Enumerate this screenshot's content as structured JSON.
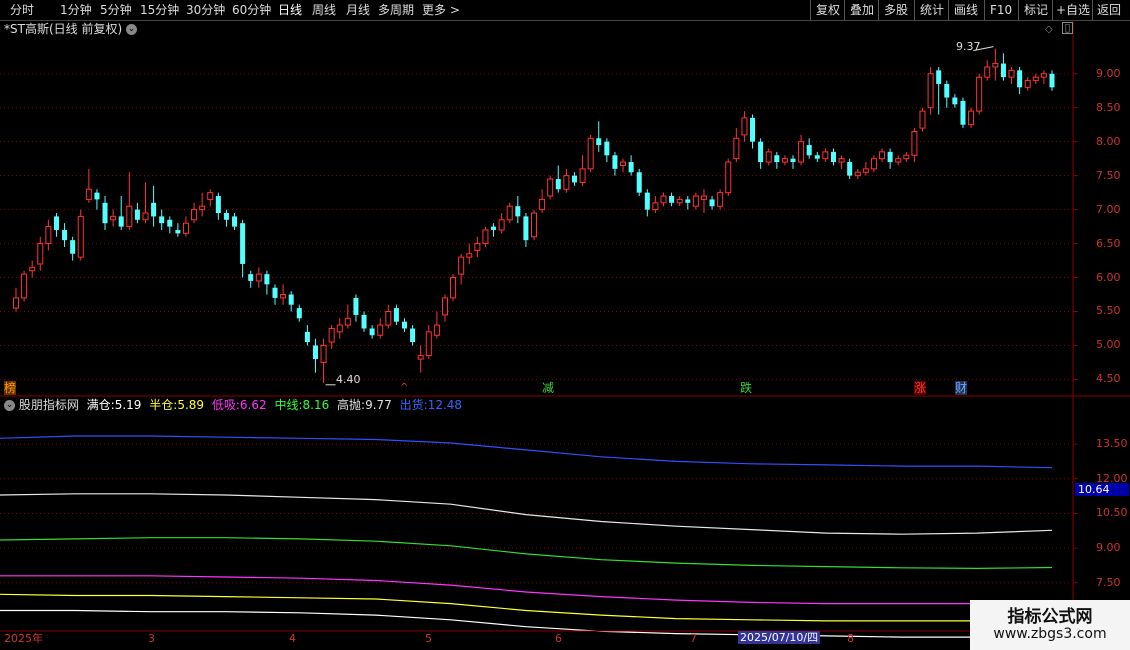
{
  "toolbar": {
    "periods": [
      "分时",
      "1分钟",
      "5分钟",
      "15分钟",
      "30分钟",
      "60分钟",
      "日线",
      "周线",
      "月线",
      "多周期",
      "更多 >"
    ],
    "active_period": "日线",
    "right_buttons": [
      "复权",
      "叠加",
      "多股",
      "统计",
      "画线",
      "F10",
      "标记",
      "+自选",
      "返回"
    ]
  },
  "stock": {
    "title": "*ST高斯(日线 前复权)",
    "high_label": "9.37",
    "low_label": "4.40"
  },
  "signals": [
    {
      "text": "榜",
      "color": "#ff9900"
    },
    {
      "text": "^",
      "color": "#ff3333"
    },
    {
      "text": "减",
      "color": "#3cd33c"
    },
    {
      "text": "跌",
      "color": "#3cd33c"
    },
    {
      "text": "涨",
      "color": "#ff3333"
    },
    {
      "text": "财",
      "color": "#66aaff"
    }
  ],
  "indicator": {
    "name": "股朋指标网",
    "items": [
      {
        "label": "满仓:",
        "value": "5.19",
        "color": "#ffffff"
      },
      {
        "label": "半仓:",
        "value": "5.89",
        "color": "#ffff33"
      },
      {
        "label": "低吸:",
        "value": "6.62",
        "color": "#ff33ff"
      },
      {
        "label": "中线:",
        "value": "8.16",
        "color": "#33ff33"
      },
      {
        "label": "高抛:",
        "value": "9.77",
        "color": "#e0e0e0"
      },
      {
        "label": "出货:",
        "value": "12.48",
        "color": "#3366ff"
      }
    ],
    "current_tag": "10.64"
  },
  "axis": {
    "price_ticks": [
      "9.00",
      "8.50",
      "8.00",
      "7.50",
      "7.00",
      "6.50",
      "6.00",
      "5.50",
      "5.00",
      "4.50"
    ],
    "indicator_ticks": [
      "13.50",
      "12.00",
      "10.50",
      "9.00",
      "7.50"
    ],
    "date_labels": [
      "2025年",
      "3",
      "4",
      "5",
      "6",
      "7",
      "2025/07/10/四",
      "8"
    ]
  },
  "watermark": {
    "main": "指标公式网",
    "url": "www.zbgs3.com"
  },
  "colors": {
    "up": "#ff3333",
    "down": "#54ffff",
    "grid": "#8b0000",
    "axis": "#8b0000"
  },
  "chart_data": {
    "type": "candlestick",
    "price_ylim": [
      4.3,
      9.6
    ],
    "candles": [
      [
        5.55,
        5.7,
        5.5,
        5.85
      ],
      [
        5.7,
        6.05,
        5.65,
        6.1
      ],
      [
        6.1,
        6.15,
        6.0,
        6.25
      ],
      [
        6.2,
        6.5,
        6.1,
        6.6
      ],
      [
        6.5,
        6.75,
        6.4,
        6.85
      ],
      [
        6.9,
        6.7,
        6.6,
        6.95
      ],
      [
        6.7,
        6.55,
        6.45,
        6.8
      ],
      [
        6.55,
        6.35,
        6.25,
        6.6
      ],
      [
        6.3,
        6.9,
        6.25,
        7.0
      ],
      [
        7.15,
        7.3,
        7.1,
        7.6
      ],
      [
        7.25,
        7.15,
        7.0,
        7.3
      ],
      [
        7.1,
        6.8,
        6.7,
        7.2
      ],
      [
        6.85,
        6.9,
        6.75,
        7.0
      ],
      [
        6.9,
        6.75,
        6.7,
        7.2
      ],
      [
        6.75,
        7.05,
        6.7,
        7.55
      ],
      [
        7.0,
        6.85,
        6.8,
        7.1
      ],
      [
        6.85,
        6.95,
        6.8,
        7.4
      ],
      [
        7.1,
        6.9,
        6.75,
        7.35
      ],
      [
        6.9,
        6.8,
        6.7,
        7.0
      ],
      [
        6.85,
        6.75,
        6.65,
        6.9
      ],
      [
        6.7,
        6.65,
        6.6,
        6.8
      ],
      [
        6.65,
        6.8,
        6.6,
        6.9
      ],
      [
        6.85,
        7.0,
        6.8,
        7.1
      ],
      [
        7.0,
        7.05,
        6.9,
        7.25
      ],
      [
        7.15,
        7.25,
        7.05,
        7.3
      ],
      [
        7.2,
        6.95,
        6.85,
        7.25
      ],
      [
        6.95,
        6.85,
        6.75,
        7.0
      ],
      [
        6.9,
        6.75,
        6.7,
        6.95
      ],
      [
        6.8,
        6.2,
        6.0,
        6.85
      ],
      [
        6.05,
        5.95,
        5.85,
        6.1
      ],
      [
        5.95,
        6.05,
        5.85,
        6.15
      ],
      [
        6.05,
        5.9,
        5.75,
        6.1
      ],
      [
        5.85,
        5.7,
        5.6,
        5.9
      ],
      [
        5.7,
        5.75,
        5.6,
        5.9
      ],
      [
        5.75,
        5.6,
        5.5,
        5.8
      ],
      [
        5.55,
        5.4,
        5.35,
        5.6
      ],
      [
        5.2,
        5.05,
        5.0,
        5.3
      ],
      [
        5.0,
        4.8,
        4.6,
        5.1
      ],
      [
        4.75,
        5.0,
        4.45,
        5.1
      ],
      [
        5.05,
        5.25,
        4.95,
        5.3
      ],
      [
        5.2,
        5.3,
        5.1,
        5.4
      ],
      [
        5.3,
        5.4,
        5.25,
        5.6
      ],
      [
        5.7,
        5.45,
        5.35,
        5.75
      ],
      [
        5.45,
        5.25,
        5.2,
        5.5
      ],
      [
        5.25,
        5.15,
        5.1,
        5.3
      ],
      [
        5.15,
        5.3,
        5.1,
        5.4
      ],
      [
        5.3,
        5.5,
        5.25,
        5.6
      ],
      [
        5.55,
        5.35,
        5.3,
        5.6
      ],
      [
        5.35,
        5.25,
        5.2,
        5.4
      ],
      [
        5.25,
        5.05,
        5.0,
        5.3
      ],
      [
        4.8,
        4.85,
        4.6,
        5.0
      ],
      [
        4.85,
        5.2,
        4.8,
        5.3
      ],
      [
        5.15,
        5.3,
        5.1,
        5.5
      ],
      [
        5.45,
        5.7,
        5.35,
        5.75
      ],
      [
        5.7,
        6.0,
        5.65,
        6.05
      ],
      [
        6.05,
        6.3,
        5.9,
        6.35
      ],
      [
        6.3,
        6.35,
        6.2,
        6.5
      ],
      [
        6.4,
        6.5,
        6.3,
        6.6
      ],
      [
        6.5,
        6.7,
        6.45,
        6.75
      ],
      [
        6.75,
        6.7,
        6.6,
        6.8
      ],
      [
        6.7,
        6.85,
        6.65,
        6.95
      ],
      [
        6.85,
        7.05,
        6.8,
        7.1
      ],
      [
        7.05,
        6.9,
        6.8,
        7.2
      ],
      [
        6.9,
        6.55,
        6.45,
        6.95
      ],
      [
        6.6,
        6.95,
        6.55,
        7.0
      ],
      [
        7.0,
        7.15,
        6.95,
        7.3
      ],
      [
        7.2,
        7.45,
        7.15,
        7.5
      ],
      [
        7.45,
        7.3,
        7.25,
        7.65
      ],
      [
        7.3,
        7.5,
        7.25,
        7.6
      ],
      [
        7.5,
        7.4,
        7.35,
        7.55
      ],
      [
        7.4,
        7.6,
        7.35,
        7.8
      ],
      [
        7.6,
        8.05,
        7.55,
        8.1
      ],
      [
        8.05,
        7.95,
        7.85,
        8.3
      ],
      [
        8.0,
        7.8,
        7.7,
        8.05
      ],
      [
        7.8,
        7.6,
        7.5,
        7.85
      ],
      [
        7.65,
        7.7,
        7.55,
        7.75
      ],
      [
        7.7,
        7.55,
        7.5,
        7.8
      ],
      [
        7.55,
        7.25,
        7.2,
        7.6
      ],
      [
        7.25,
        7.0,
        6.9,
        7.3
      ],
      [
        7.0,
        7.1,
        6.95,
        7.2
      ],
      [
        7.1,
        7.2,
        7.05,
        7.25
      ],
      [
        7.2,
        7.1,
        7.05,
        7.25
      ],
      [
        7.1,
        7.15,
        7.05,
        7.2
      ],
      [
        7.15,
        7.1,
        7.0,
        7.2
      ],
      [
        7.05,
        7.2,
        7.0,
        7.25
      ],
      [
        7.15,
        7.2,
        6.95,
        7.3
      ],
      [
        7.15,
        7.05,
        7.0,
        7.2
      ],
      [
        7.05,
        7.25,
        7.0,
        7.3
      ],
      [
        7.25,
        7.7,
        7.2,
        7.75
      ],
      [
        7.75,
        8.05,
        7.7,
        8.2
      ],
      [
        8.1,
        8.35,
        8.0,
        8.45
      ],
      [
        8.35,
        8.0,
        7.9,
        8.4
      ],
      [
        8.0,
        7.7,
        7.6,
        8.05
      ],
      [
        7.7,
        7.85,
        7.65,
        7.9
      ],
      [
        7.8,
        7.7,
        7.6,
        7.85
      ],
      [
        7.7,
        7.75,
        7.65,
        7.8
      ],
      [
        7.75,
        7.7,
        7.6,
        7.8
      ],
      [
        7.7,
        8.0,
        7.65,
        8.1
      ],
      [
        7.95,
        7.8,
        7.75,
        8.05
      ],
      [
        7.8,
        7.75,
        7.7,
        7.85
      ],
      [
        7.75,
        7.85,
        7.7,
        7.9
      ],
      [
        7.85,
        7.7,
        7.65,
        7.9
      ],
      [
        7.7,
        7.75,
        7.6,
        7.8
      ],
      [
        7.7,
        7.5,
        7.45,
        7.75
      ],
      [
        7.5,
        7.55,
        7.45,
        7.6
      ],
      [
        7.55,
        7.6,
        7.5,
        7.7
      ],
      [
        7.6,
        7.75,
        7.55,
        7.8
      ],
      [
        7.75,
        7.85,
        7.7,
        7.9
      ],
      [
        7.85,
        7.7,
        7.6,
        7.9
      ],
      [
        7.7,
        7.75,
        7.65,
        7.8
      ],
      [
        7.75,
        7.8,
        7.7,
        7.85
      ],
      [
        7.8,
        8.15,
        7.7,
        8.2
      ],
      [
        8.2,
        8.45,
        8.15,
        8.5
      ],
      [
        8.5,
        9.0,
        8.4,
        9.1
      ],
      [
        9.05,
        8.85,
        8.4,
        9.1
      ],
      [
        8.85,
        8.65,
        8.5,
        8.9
      ],
      [
        8.65,
        8.55,
        8.5,
        8.7
      ],
      [
        8.6,
        8.25,
        8.2,
        8.65
      ],
      [
        8.25,
        8.45,
        8.2,
        8.5
      ],
      [
        8.45,
        8.95,
        8.4,
        9.0
      ],
      [
        8.95,
        9.1,
        8.9,
        9.2
      ],
      [
        9.1,
        9.15,
        8.9,
        9.37
      ],
      [
        9.15,
        8.95,
        8.9,
        9.3
      ],
      [
        8.95,
        9.05,
        8.85,
        9.1
      ],
      [
        9.05,
        8.8,
        8.7,
        9.1
      ],
      [
        8.8,
        8.9,
        8.75,
        8.95
      ],
      [
        8.9,
        8.95,
        8.85,
        9.0
      ],
      [
        8.95,
        9.0,
        8.85,
        9.05
      ],
      [
        9.0,
        8.8,
        8.75,
        9.05
      ]
    ],
    "indicator_ylim": [
      5.5,
      14.5
    ],
    "indicator_series": [
      {
        "name": "出货",
        "color": "#3050ff",
        "values": [
          13.75,
          13.85,
          13.85,
          13.8,
          13.75,
          13.7,
          13.55,
          13.25,
          12.95,
          12.75,
          12.65,
          12.6,
          12.55,
          12.55,
          12.48
        ]
      },
      {
        "name": "高抛",
        "color": "#e8e8e8",
        "values": [
          11.3,
          11.35,
          11.35,
          11.3,
          11.2,
          11.1,
          10.9,
          10.45,
          10.15,
          9.95,
          9.8,
          9.65,
          9.6,
          9.65,
          9.77
        ]
      },
      {
        "name": "中线",
        "color": "#33dd33",
        "values": [
          9.35,
          9.4,
          9.45,
          9.45,
          9.4,
          9.3,
          9.1,
          8.75,
          8.5,
          8.35,
          8.25,
          8.2,
          8.15,
          8.12,
          8.16
        ]
      },
      {
        "name": "低吸",
        "color": "#ff33ff",
        "values": [
          7.8,
          7.8,
          7.8,
          7.75,
          7.7,
          7.6,
          7.4,
          7.1,
          6.9,
          6.75,
          6.65,
          6.6,
          6.6,
          6.6,
          6.62
        ]
      },
      {
        "name": "半仓",
        "color": "#ffff33",
        "values": [
          7.0,
          6.95,
          6.95,
          6.9,
          6.85,
          6.8,
          6.6,
          6.3,
          6.1,
          5.95,
          5.9,
          5.85,
          5.85,
          5.85,
          5.89
        ]
      },
      {
        "name": "满仓",
        "color": "#ffffff",
        "values": [
          6.3,
          6.3,
          6.25,
          6.25,
          6.2,
          6.1,
          5.9,
          5.6,
          5.4,
          5.3,
          5.25,
          5.2,
          5.15,
          5.15,
          5.19
        ]
      }
    ]
  }
}
